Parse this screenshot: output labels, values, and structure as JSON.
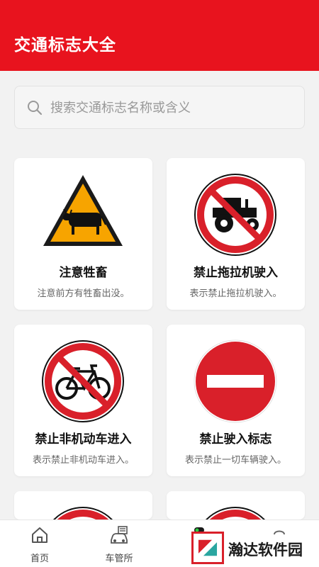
{
  "app": {
    "title": "交通标志大全",
    "brand_color": "#e8131e"
  },
  "search": {
    "placeholder": "搜索交通标志名称或含义",
    "icon": "search-icon"
  },
  "cards": [
    {
      "title": "注意牲畜",
      "desc": "注意前方有牲畜出没。",
      "icon": "cattle-warning-sign"
    },
    {
      "title": "禁止拖拉机驶入",
      "desc": "表示禁止拖拉机驶入。",
      "icon": "no-tractor-sign"
    },
    {
      "title": "禁止非机动车进入",
      "desc": "表示禁止非机动车进入。",
      "icon": "no-bicycle-sign"
    },
    {
      "title": "禁止驶入标志",
      "desc": "表示禁止一切车辆驶入。",
      "icon": "no-entry-sign"
    },
    {
      "title": "",
      "desc": "",
      "icon": "prohibition-sign"
    },
    {
      "title": "",
      "desc": "",
      "icon": "prohibition-sign"
    }
  ],
  "nav": {
    "items": [
      {
        "label": "首页",
        "icon": "home-icon"
      },
      {
        "label": "车管所",
        "icon": "car-office-icon"
      },
      {
        "label": "",
        "icon": "toggle-icon"
      },
      {
        "label": "",
        "icon": "profile-icon"
      }
    ]
  },
  "watermark": {
    "text": "瀚达软件园"
  }
}
